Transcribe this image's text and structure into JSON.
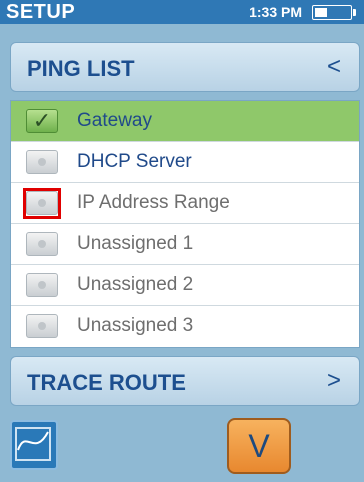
{
  "header": {
    "title": "SETUP",
    "time": "1:33 PM",
    "battery_level": 0.35
  },
  "ping_list_button": {
    "label": "PING LIST",
    "chevron": "<"
  },
  "ping_list": {
    "items": [
      {
        "label": "Gateway",
        "checked": true,
        "check_symbol": "✓"
      },
      {
        "label": "DHCP Server",
        "checked": false
      },
      {
        "label": "IP Address Range",
        "checked": false,
        "highlighted": true
      },
      {
        "label": "Unassigned 1",
        "checked": false
      },
      {
        "label": "Unassigned 2",
        "checked": false
      },
      {
        "label": "Unassigned 3",
        "checked": false
      }
    ]
  },
  "trace_route_button": {
    "label": "TRACE ROUTE",
    "chevron": ">"
  },
  "bottom_bar": {
    "left_icon": "graph-icon",
    "down_button_glyph": "V"
  }
}
